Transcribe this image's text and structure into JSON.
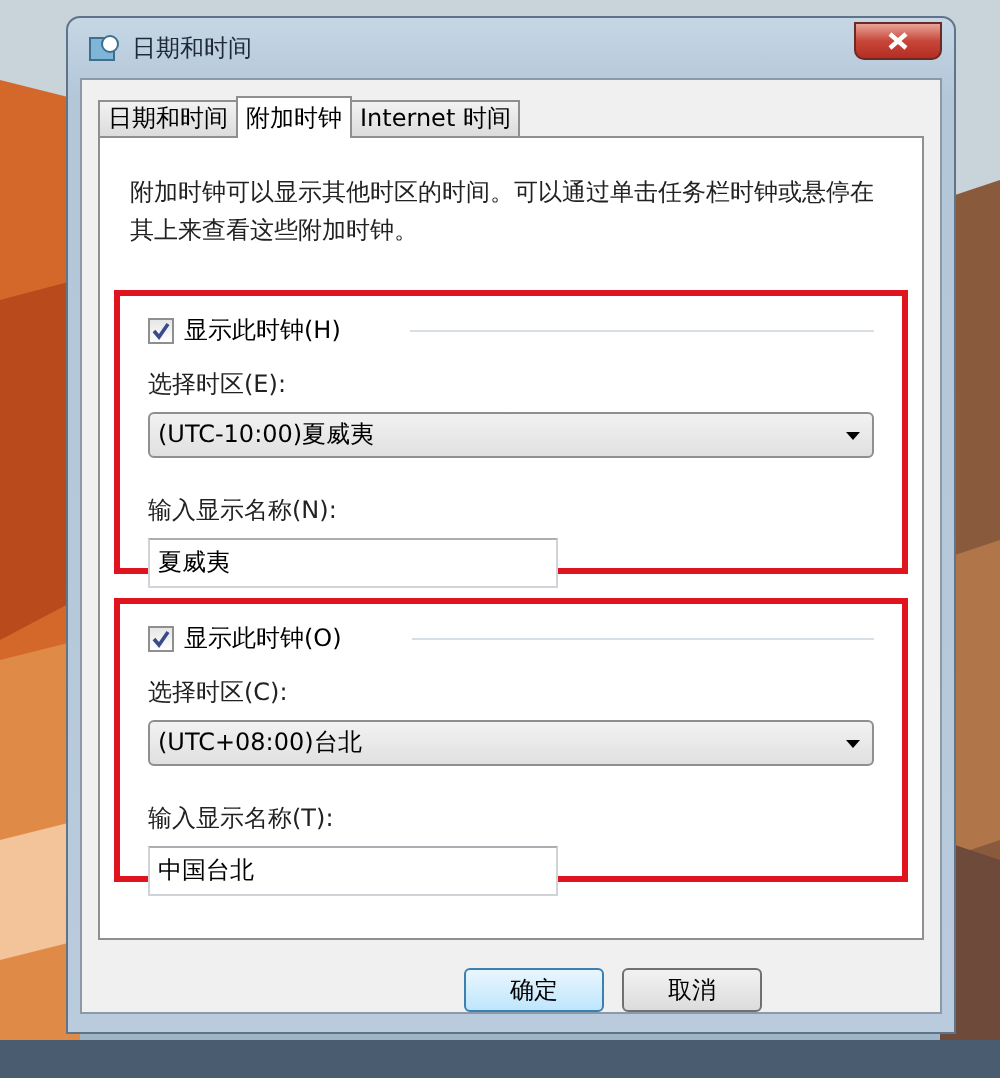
{
  "window": {
    "title": "日期和时间"
  },
  "tabs": [
    {
      "label": "日期和时间",
      "selected": false
    },
    {
      "label": "附加时钟",
      "selected": true
    },
    {
      "label": "Internet 时间",
      "selected": false
    }
  ],
  "description": "附加时钟可以显示其他时区的时间。可以通过单击任务栏时钟或悬停在其上来查看这些附加时钟。",
  "clocks": [
    {
      "show_label": "显示此时钟(H)",
      "checked": true,
      "zone_label": "选择时区(E):",
      "zone": "(UTC-10:00)夏威夷",
      "name_label": "输入显示名称(N):",
      "name": "夏威夷",
      "highlighted": true
    },
    {
      "show_label": "显示此时钟(O)",
      "checked": true,
      "zone_label": "选择时区(C):",
      "zone": "(UTC+08:00)台北",
      "name_label": "输入显示名称(T):",
      "name": "中国台北",
      "highlighted": true
    }
  ],
  "buttons": [
    {
      "label": "确定",
      "default": true
    },
    {
      "label": "取消",
      "default": false
    }
  ]
}
